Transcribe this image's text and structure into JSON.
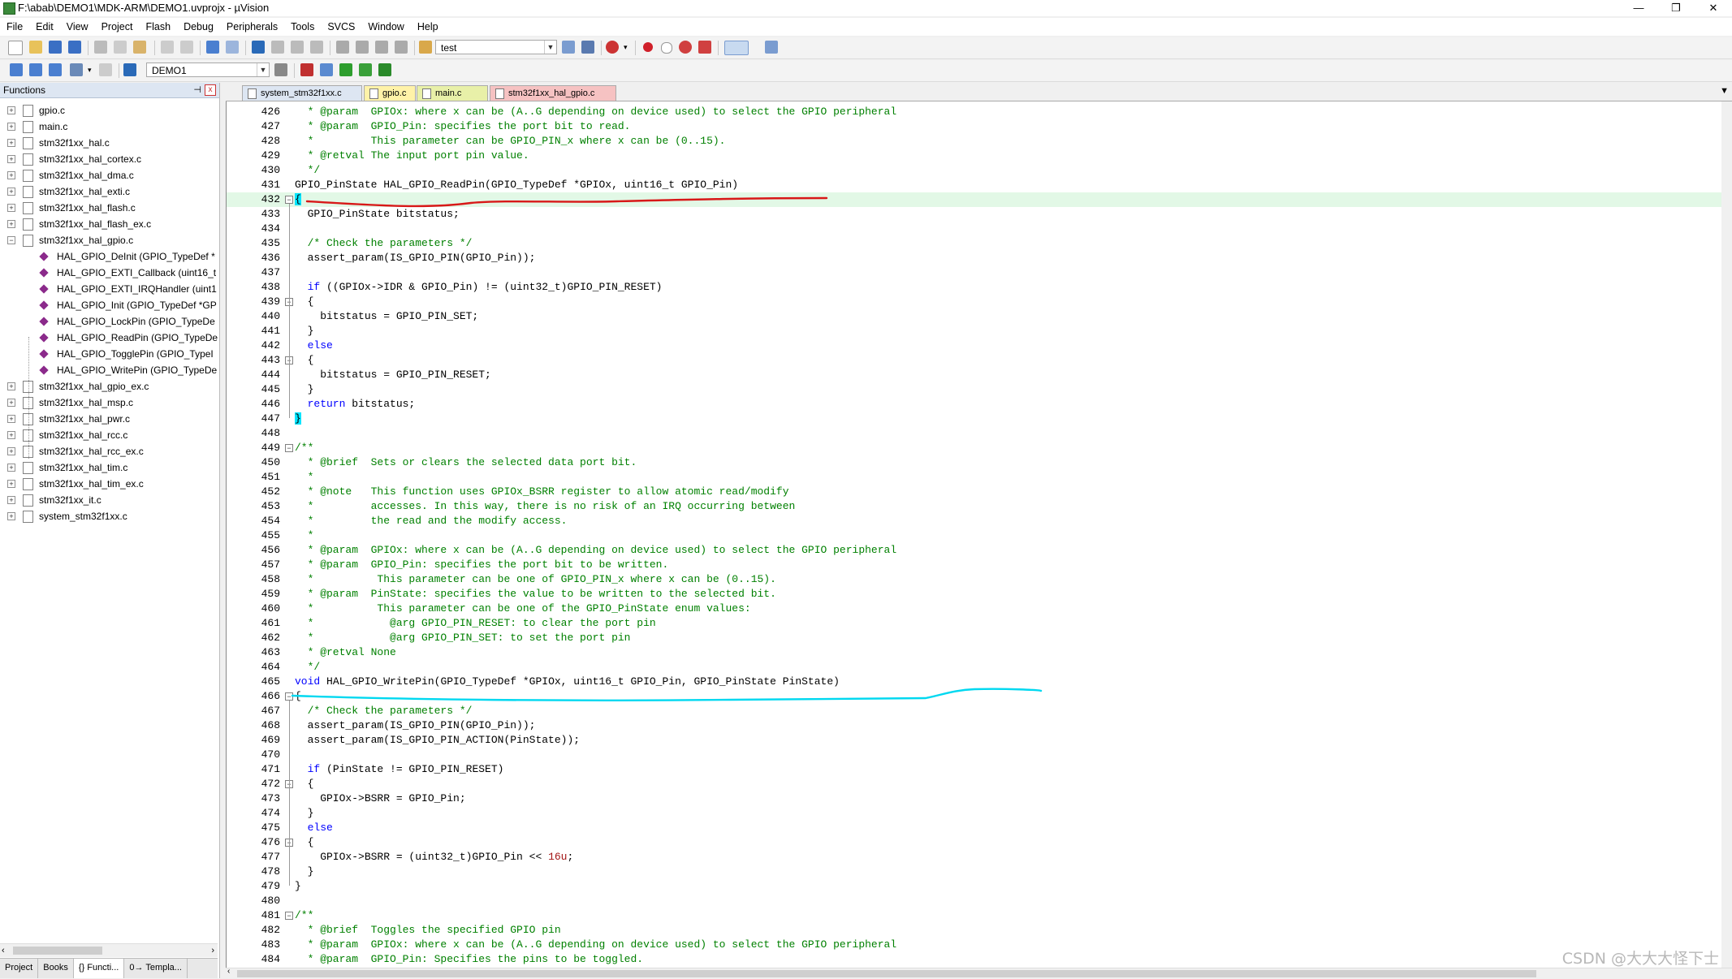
{
  "window": {
    "title": "F:\\abab\\DEMO1\\MDK-ARM\\DEMO1.uvprojx - µVision",
    "minimize": "—",
    "maximize": "❐",
    "close": "✕"
  },
  "menu": [
    "File",
    "Edit",
    "View",
    "Project",
    "Flash",
    "Debug",
    "Peripherals",
    "Tools",
    "SVCS",
    "Window",
    "Help"
  ],
  "toolbar": {
    "find_combo": "test",
    "target_combo": "DEMO1"
  },
  "functions_panel": {
    "title": "Functions",
    "pin": "📌",
    "close": "x",
    "items": [
      {
        "label": "gpio.c",
        "expand": "+",
        "type": "file"
      },
      {
        "label": "main.c",
        "expand": "+",
        "type": "file"
      },
      {
        "label": "stm32f1xx_hal.c",
        "expand": "+",
        "type": "file"
      },
      {
        "label": "stm32f1xx_hal_cortex.c",
        "expand": "+",
        "type": "file"
      },
      {
        "label": "stm32f1xx_hal_dma.c",
        "expand": "+",
        "type": "file"
      },
      {
        "label": "stm32f1xx_hal_exti.c",
        "expand": "+",
        "type": "file"
      },
      {
        "label": "stm32f1xx_hal_flash.c",
        "expand": "+",
        "type": "file"
      },
      {
        "label": "stm32f1xx_hal_flash_ex.c",
        "expand": "+",
        "type": "file"
      },
      {
        "label": "stm32f1xx_hal_gpio.c",
        "expand": "−",
        "type": "file"
      },
      {
        "label": "HAL_GPIO_DeInit (GPIO_TypeDef *",
        "type": "fn"
      },
      {
        "label": "HAL_GPIO_EXTI_Callback (uint16_t",
        "type": "fn"
      },
      {
        "label": "HAL_GPIO_EXTI_IRQHandler (uint1",
        "type": "fn"
      },
      {
        "label": "HAL_GPIO_Init (GPIO_TypeDef *GP",
        "type": "fn"
      },
      {
        "label": "HAL_GPIO_LockPin (GPIO_TypeDe",
        "type": "fn"
      },
      {
        "label": "HAL_GPIO_ReadPin (GPIO_TypeDe",
        "type": "fn"
      },
      {
        "label": "HAL_GPIO_TogglePin (GPIO_TypeI",
        "type": "fn"
      },
      {
        "label": "HAL_GPIO_WritePin (GPIO_TypeDe",
        "type": "fn"
      },
      {
        "label": "stm32f1xx_hal_gpio_ex.c",
        "expand": "+",
        "type": "file"
      },
      {
        "label": "stm32f1xx_hal_msp.c",
        "expand": "+",
        "type": "file"
      },
      {
        "label": "stm32f1xx_hal_pwr.c",
        "expand": "+",
        "type": "file"
      },
      {
        "label": "stm32f1xx_hal_rcc.c",
        "expand": "+",
        "type": "file"
      },
      {
        "label": "stm32f1xx_hal_rcc_ex.c",
        "expand": "+",
        "type": "file"
      },
      {
        "label": "stm32f1xx_hal_tim.c",
        "expand": "+",
        "type": "file"
      },
      {
        "label": "stm32f1xx_hal_tim_ex.c",
        "expand": "+",
        "type": "file"
      },
      {
        "label": "stm32f1xx_it.c",
        "expand": "+",
        "type": "file"
      },
      {
        "label": "system_stm32f1xx.c",
        "expand": "+",
        "type": "file"
      }
    ],
    "bottom_tabs": [
      "Project",
      "Books",
      "{} Functi...",
      "0→ Templa..."
    ]
  },
  "file_tabs": [
    {
      "label": "system_stm32f1xx.c",
      "bg": "#dde6f2"
    },
    {
      "label": "gpio.c",
      "bg": "#fff2a8"
    },
    {
      "label": "main.c",
      "bg": "#e8f0a8"
    },
    {
      "label": "stm32f1xx_hal_gpio.c",
      "bg": "#f6c2c2"
    }
  ],
  "editor": {
    "current_line": 432,
    "lines": [
      {
        "n": 426,
        "parts": [
          [
            "cm",
            "  * @param  GPIOx: where x can be (A..G depending on device used) to select the GPIO peripheral"
          ]
        ]
      },
      {
        "n": 427,
        "parts": [
          [
            "cm",
            "  * @param  GPIO_Pin: specifies the port bit to read."
          ]
        ]
      },
      {
        "n": 428,
        "parts": [
          [
            "cm",
            "  *         This parameter can be GPIO_PIN_x where x can be (0..15)."
          ]
        ]
      },
      {
        "n": 429,
        "parts": [
          [
            "cm",
            "  * @retval The input port pin value."
          ]
        ]
      },
      {
        "n": 430,
        "parts": [
          [
            "cm",
            "  */"
          ]
        ]
      },
      {
        "n": 431,
        "parts": [
          [
            "tx",
            "GPIO_PinState HAL_GPIO_ReadPin(GPIO_TypeDef *GPIOx, uint16_t GPIO_Pin)"
          ]
        ]
      },
      {
        "n": 432,
        "fold": "−",
        "hl": true,
        "parts": [
          [
            "br",
            "{"
          ]
        ]
      },
      {
        "n": 433,
        "parts": [
          [
            "tx",
            "  GPIO_PinState bitstatus;"
          ]
        ]
      },
      {
        "n": 434,
        "parts": []
      },
      {
        "n": 435,
        "parts": [
          [
            "cm",
            "  /* Check the parameters */"
          ]
        ]
      },
      {
        "n": 436,
        "parts": [
          [
            "tx",
            "  assert_param(IS_GPIO_PIN(GPIO_Pin));"
          ]
        ]
      },
      {
        "n": 437,
        "parts": []
      },
      {
        "n": 438,
        "parts": [
          [
            "kw",
            "  if"
          ],
          [
            "tx",
            " ((GPIOx->IDR & GPIO_Pin) != (uint32_t)GPIO_PIN_RESET)"
          ]
        ]
      },
      {
        "n": 439,
        "fold": "−",
        "parts": [
          [
            "tx",
            "  {"
          ]
        ]
      },
      {
        "n": 440,
        "parts": [
          [
            "tx",
            "    bitstatus = GPIO_PIN_SET;"
          ]
        ]
      },
      {
        "n": 441,
        "parts": [
          [
            "tx",
            "  }"
          ]
        ]
      },
      {
        "n": 442,
        "parts": [
          [
            "kw",
            "  else"
          ]
        ]
      },
      {
        "n": 443,
        "fold": "−",
        "parts": [
          [
            "tx",
            "  {"
          ]
        ]
      },
      {
        "n": 444,
        "parts": [
          [
            "tx",
            "    bitstatus = GPIO_PIN_RESET;"
          ]
        ]
      },
      {
        "n": 445,
        "parts": [
          [
            "tx",
            "  }"
          ]
        ]
      },
      {
        "n": 446,
        "parts": [
          [
            "kw",
            "  return"
          ],
          [
            "tx",
            " bitstatus;"
          ]
        ]
      },
      {
        "n": 447,
        "parts": [
          [
            "br",
            "}"
          ]
        ]
      },
      {
        "n": 448,
        "parts": []
      },
      {
        "n": 449,
        "fold": "−",
        "parts": [
          [
            "cm",
            "/**"
          ]
        ]
      },
      {
        "n": 450,
        "parts": [
          [
            "cm",
            "  * @brief  Sets or clears the selected data port bit."
          ]
        ]
      },
      {
        "n": 451,
        "parts": [
          [
            "cm",
            "  *"
          ]
        ]
      },
      {
        "n": 452,
        "parts": [
          [
            "cm",
            "  * @note   This function uses GPIOx_BSRR register to allow atomic read/modify"
          ]
        ]
      },
      {
        "n": 453,
        "parts": [
          [
            "cm",
            "  *         accesses. In this way, there is no risk of an IRQ occurring between"
          ]
        ]
      },
      {
        "n": 454,
        "parts": [
          [
            "cm",
            "  *         the read and the modify access."
          ]
        ]
      },
      {
        "n": 455,
        "parts": [
          [
            "cm",
            "  *"
          ]
        ]
      },
      {
        "n": 456,
        "parts": [
          [
            "cm",
            "  * @param  GPIOx: where x can be (A..G depending on device used) to select the GPIO peripheral"
          ]
        ]
      },
      {
        "n": 457,
        "parts": [
          [
            "cm",
            "  * @param  GPIO_Pin: specifies the port bit to be written."
          ]
        ]
      },
      {
        "n": 458,
        "parts": [
          [
            "cm",
            "  *          This parameter can be one of GPIO_PIN_x where x can be (0..15)."
          ]
        ]
      },
      {
        "n": 459,
        "parts": [
          [
            "cm",
            "  * @param  PinState: specifies the value to be written to the selected bit."
          ]
        ]
      },
      {
        "n": 460,
        "parts": [
          [
            "cm",
            "  *          This parameter can be one of the GPIO_PinState enum values:"
          ]
        ]
      },
      {
        "n": 461,
        "parts": [
          [
            "cm",
            "  *            @arg GPIO_PIN_RESET: to clear the port pin"
          ]
        ]
      },
      {
        "n": 462,
        "parts": [
          [
            "cm",
            "  *            @arg GPIO_PIN_SET: to set the port pin"
          ]
        ]
      },
      {
        "n": 463,
        "parts": [
          [
            "cm",
            "  * @retval None"
          ]
        ]
      },
      {
        "n": 464,
        "parts": [
          [
            "cm",
            "  */"
          ]
        ]
      },
      {
        "n": 465,
        "parts": [
          [
            "kw",
            "void"
          ],
          [
            "tx",
            " HAL_GPIO_WritePin(GPIO_TypeDef *GPIOx, uint16_t GPIO_Pin, GPIO_PinState PinState)"
          ]
        ]
      },
      {
        "n": 466,
        "fold": "−",
        "parts": [
          [
            "tx",
            "{"
          ]
        ]
      },
      {
        "n": 467,
        "parts": [
          [
            "cm",
            "  /* Check the parameters */"
          ]
        ]
      },
      {
        "n": 468,
        "parts": [
          [
            "tx",
            "  assert_param(IS_GPIO_PIN(GPIO_Pin));"
          ]
        ]
      },
      {
        "n": 469,
        "parts": [
          [
            "tx",
            "  assert_param(IS_GPIO_PIN_ACTION(PinState));"
          ]
        ]
      },
      {
        "n": 470,
        "parts": []
      },
      {
        "n": 471,
        "parts": [
          [
            "kw",
            "  if"
          ],
          [
            "tx",
            " (PinState != GPIO_PIN_RESET)"
          ]
        ]
      },
      {
        "n": 472,
        "fold": "−",
        "parts": [
          [
            "tx",
            "  {"
          ]
        ]
      },
      {
        "n": 473,
        "parts": [
          [
            "tx",
            "    GPIOx->BSRR = GPIO_Pin;"
          ]
        ]
      },
      {
        "n": 474,
        "parts": [
          [
            "tx",
            "  }"
          ]
        ]
      },
      {
        "n": 475,
        "parts": [
          [
            "kw",
            "  else"
          ]
        ]
      },
      {
        "n": 476,
        "fold": "−",
        "parts": [
          [
            "tx",
            "  {"
          ]
        ]
      },
      {
        "n": 477,
        "parts": [
          [
            "tx",
            "    GPIOx->BSRR = (uint32_t)GPIO_Pin << "
          ],
          [
            "num",
            "16u"
          ],
          [
            "tx",
            ";"
          ]
        ]
      },
      {
        "n": 478,
        "parts": [
          [
            "tx",
            "  }"
          ]
        ]
      },
      {
        "n": 479,
        "parts": [
          [
            "tx",
            "}"
          ]
        ]
      },
      {
        "n": 480,
        "parts": []
      },
      {
        "n": 481,
        "fold": "−",
        "parts": [
          [
            "cm",
            "/**"
          ]
        ]
      },
      {
        "n": 482,
        "parts": [
          [
            "cm",
            "  * @brief  Toggles the specified GPIO pin"
          ]
        ]
      },
      {
        "n": 483,
        "parts": [
          [
            "cm",
            "  * @param  GPIOx: where x can be (A..G depending on device used) to select the GPIO peripheral"
          ]
        ]
      },
      {
        "n": 484,
        "parts": [
          [
            "cm",
            "  * @param  GPIO_Pin: Specifies the pins to be toggled."
          ]
        ]
      }
    ]
  },
  "colors": {
    "comment": "#008000",
    "keyword": "#0000ff",
    "number": "#a31515",
    "current_line_bg": "#e2f8e6",
    "brace_match": "#00e5ff",
    "annotation_red": "#d81818",
    "annotation_cyan": "#00d8f0"
  },
  "watermark": "CSDN @大大大怪下士"
}
